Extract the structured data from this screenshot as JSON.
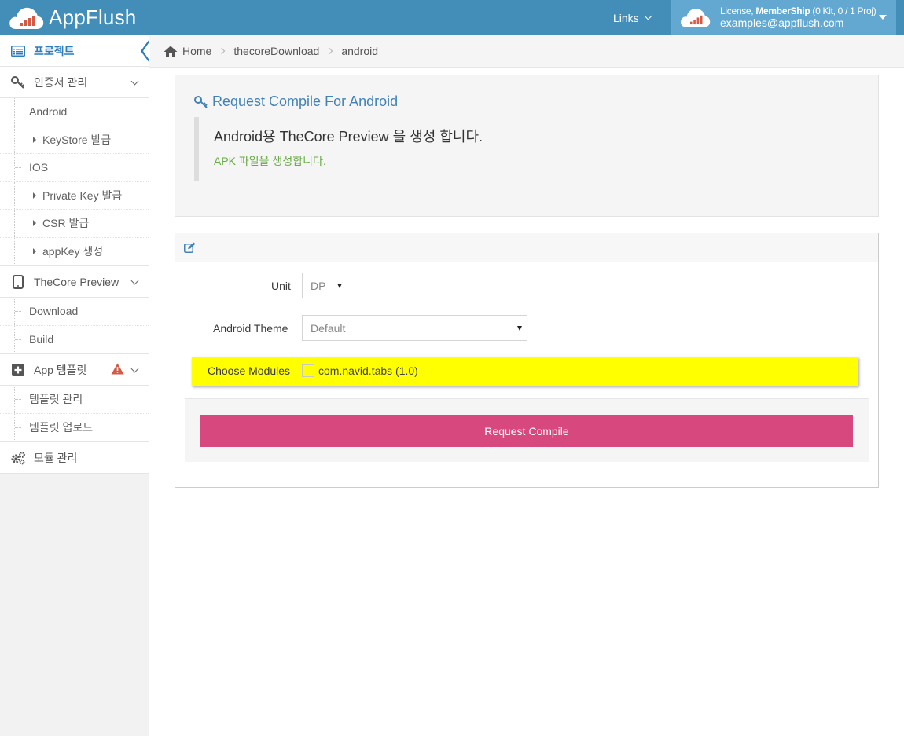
{
  "header": {
    "brand": "AppFlush",
    "links_label": "Links",
    "user_license_prefix": "License, ",
    "user_license_bold": "MemberShip",
    "user_license_suffix": " (0 Kit, 0 / 1 Proj)",
    "user_email": "examples@appflush.com"
  },
  "sidebar": {
    "project": "프로젝트",
    "cert": {
      "label": "인증서 관리",
      "items": [
        "Android",
        "KeyStore 발급",
        "IOS",
        "Private Key 발급",
        "CSR 발급",
        "appKey 생성"
      ]
    },
    "preview": {
      "label": "TheCore Preview",
      "items": [
        "Download",
        "Build"
      ]
    },
    "template": {
      "label": "App 템플릿",
      "items": [
        "템플릿 관리",
        "템플릿 업로드"
      ]
    },
    "module": "모듈 관리"
  },
  "breadcrumb": {
    "home": "Home",
    "level1": "thecoreDownload",
    "level2": "android"
  },
  "well": {
    "title": "Request Compile For Android",
    "main": "Android용 TheCore Preview 을 생성 합니다.",
    "sub": "APK 파일을 생성합니다."
  },
  "form": {
    "unit_label": "Unit",
    "unit_value": "DP",
    "theme_label": "Android Theme",
    "theme_value": "Default",
    "modules_label": "Choose Modules",
    "module_option": "com.navid.tabs (1.0)",
    "submit": "Request Compile"
  },
  "colors": {
    "header": "#438eb9",
    "user_box": "#62a8d1",
    "accent": "#2b7dbc",
    "highlight": "#ffff00",
    "button": "#d6487e",
    "success_text": "#69aa46",
    "warning": "#d15b47"
  }
}
